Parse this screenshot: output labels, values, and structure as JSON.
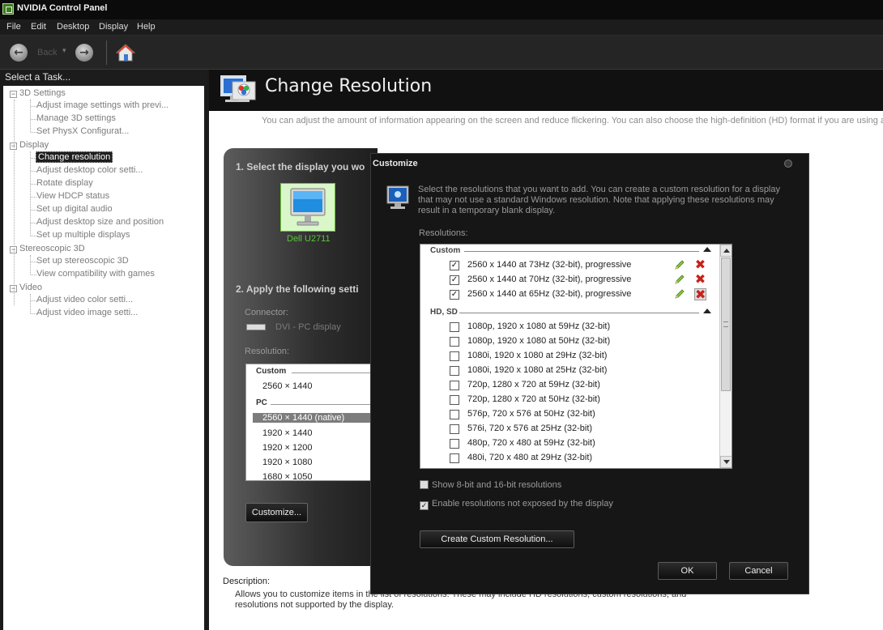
{
  "window": {
    "title": "NVIDIA Control Panel"
  },
  "menu": {
    "items": [
      "File",
      "Edit",
      "Desktop",
      "Display",
      "Help"
    ]
  },
  "toolbar": {
    "back_label": "Back",
    "back_arrow": "←",
    "forward_arrow": "→",
    "dropdown_glyph": "▾"
  },
  "task_panel": {
    "header": "Select a Task...",
    "categories": [
      {
        "label": "3D Settings",
        "expander": "−",
        "items": [
          "Adjust image settings with previ...",
          "Manage 3D settings",
          "Set PhysX Configurat..."
        ]
      },
      {
        "label": "Display",
        "expander": "−",
        "items": [
          "Change resolution",
          "Adjust desktop color setti...",
          "Rotate display",
          "View HDCP status",
          "Set up digital audio",
          "Adjust desktop size and position",
          "Set up multiple displays"
        ]
      },
      {
        "label": "Stereoscopic 3D",
        "expander": "−",
        "items": [
          "Set up stereoscopic 3D",
          "View compatibility with games"
        ]
      },
      {
        "label": "Video",
        "expander": "−",
        "items": [
          "Adjust video color setti...",
          "Adjust video image setti..."
        ]
      }
    ]
  },
  "page": {
    "title": "Change Resolution",
    "intro": "You can adjust the amount of information appearing on the screen and reduce flickering. You can also choose the high-definition (HD) format if you are using an HD",
    "step1": "1. Select the display you wo",
    "display_name": "Dell U2711",
    "step2": "2. Apply the following setti",
    "connector_label": "Connector:",
    "connector_value": "DVI - PC display",
    "resolution_label": "Resolution:",
    "resolution_groups": [
      {
        "label": "Custom",
        "items": [
          "2560 × 1440"
        ]
      },
      {
        "label": "PC",
        "items": [
          "2560 × 1440 (native)",
          "1920 × 1440",
          "1920 × 1200",
          "1920 × 1080",
          "1680 × 1050"
        ]
      }
    ],
    "selected_resolution": "2560 × 1440 (native)",
    "customize_button": "Customize...",
    "description_label": "Description:",
    "description_text": "Allows you to customize items in the list of resolutions. These may include HD resolutions, custom resolutions, and resolutions not supported by the display."
  },
  "dialog": {
    "title": "Customize",
    "description": "Select the resolutions that you want to add. You can create a custom resolution for a display that may not use a standard Windows resolution. Note that applying these resolutions may result in a temporary blank display.",
    "resolutions_label": "Resolutions:",
    "custom_group": "Custom",
    "custom_rows": [
      {
        "label": "2560 x 1440 at 73Hz (32-bit), progressive",
        "checked": true
      },
      {
        "label": "2560 x 1440 at 70Hz (32-bit), progressive",
        "checked": true
      },
      {
        "label": "2560 x 1440 at 65Hz (32-bit), progressive",
        "checked": true
      }
    ],
    "hd_group": "HD, SD",
    "hd_rows": [
      {
        "label": "1080p, 1920 x 1080 at 59Hz (32-bit)",
        "checked": false
      },
      {
        "label": "1080p, 1920 x 1080 at 50Hz (32-bit)",
        "checked": false
      },
      {
        "label": "1080i, 1920 x 1080 at 29Hz (32-bit)",
        "checked": false
      },
      {
        "label": "1080i, 1920 x 1080 at 25Hz (32-bit)",
        "checked": false
      },
      {
        "label": "720p, 1280 x 720 at 59Hz (32-bit)",
        "checked": false
      },
      {
        "label": "720p, 1280 x 720 at 50Hz (32-bit)",
        "checked": false
      },
      {
        "label": "576p, 720 x 576 at 50Hz (32-bit)",
        "checked": false
      },
      {
        "label": "576i, 720 x 576 at 25Hz (32-bit)",
        "checked": false
      },
      {
        "label": "480p, 720 x 480 at 59Hz (32-bit)",
        "checked": false
      },
      {
        "label": "480i, 720 x 480 at 29Hz (32-bit)",
        "checked": false
      }
    ],
    "check_glyph": "✓",
    "delete_glyph": "✖",
    "option_show_8_16": {
      "label": "Show 8-bit and 16-bit resolutions",
      "checked": false
    },
    "option_enable_unexposed": {
      "label": "Enable resolutions not exposed by the display",
      "checked": true
    },
    "create_button": "Create Custom Resolution...",
    "ok_button": "OK",
    "cancel_button": "Cancel"
  },
  "colors": {
    "accent_green": "#76b900",
    "delete_red": "#c8211b"
  }
}
